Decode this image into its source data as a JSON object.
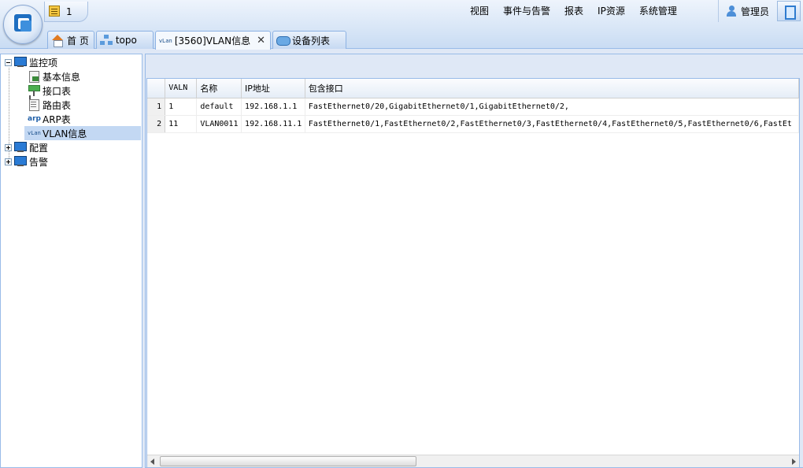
{
  "header": {
    "notification_count": "1",
    "menu": [
      "视图",
      "事件与告警",
      "报表",
      "IP资源",
      "系统管理"
    ],
    "user_label": "管理员"
  },
  "tabs": [
    {
      "label": "首 页",
      "icon": "home-icon"
    },
    {
      "label": "topo",
      "icon": "topo-icon"
    },
    {
      "label": "[3560]VLAN信息",
      "icon": "vlan-icon",
      "icon_text": "vLan",
      "active": true,
      "closable": true,
      "close_glyph": "✕"
    },
    {
      "label": "设备列表",
      "icon": "device-list-icon"
    }
  ],
  "tree": {
    "root_monitor": "监控项",
    "monitor_children": [
      {
        "label": "基本信息",
        "icon": "basic-info-icon"
      },
      {
        "label": "接口表",
        "icon": "interface-icon"
      },
      {
        "label": "路由表",
        "icon": "route-table-icon"
      },
      {
        "label": "ARP表",
        "icon": "arp-icon",
        "icon_text": "arp"
      },
      {
        "label": "VLAN信息",
        "icon": "vlan-icon",
        "icon_text": "vLan",
        "selected": true
      }
    ],
    "config": "配置",
    "alarm": "告警"
  },
  "grid": {
    "columns": [
      "VALN",
      "名称",
      "IP地址",
      "包含接口"
    ],
    "rows": [
      {
        "num": "1",
        "vlan": "1",
        "name": "default",
        "ip": "192.168.1.1",
        "ports": "FastEthernet0/20,GigabitEthernet0/1,GigabitEthernet0/2,"
      },
      {
        "num": "2",
        "vlan": "11",
        "name": "VLAN0011",
        "ip": "192.168.11.1",
        "ports": "FastEthernet0/1,FastEthernet0/2,FastEthernet0/3,FastEthernet0/4,FastEthernet0/5,FastEthernet0/6,FastEt"
      }
    ]
  },
  "colors": {
    "header_bg": "#c9dcf3",
    "border": "#99bbe8",
    "selected_row": "#c3d8f3"
  }
}
